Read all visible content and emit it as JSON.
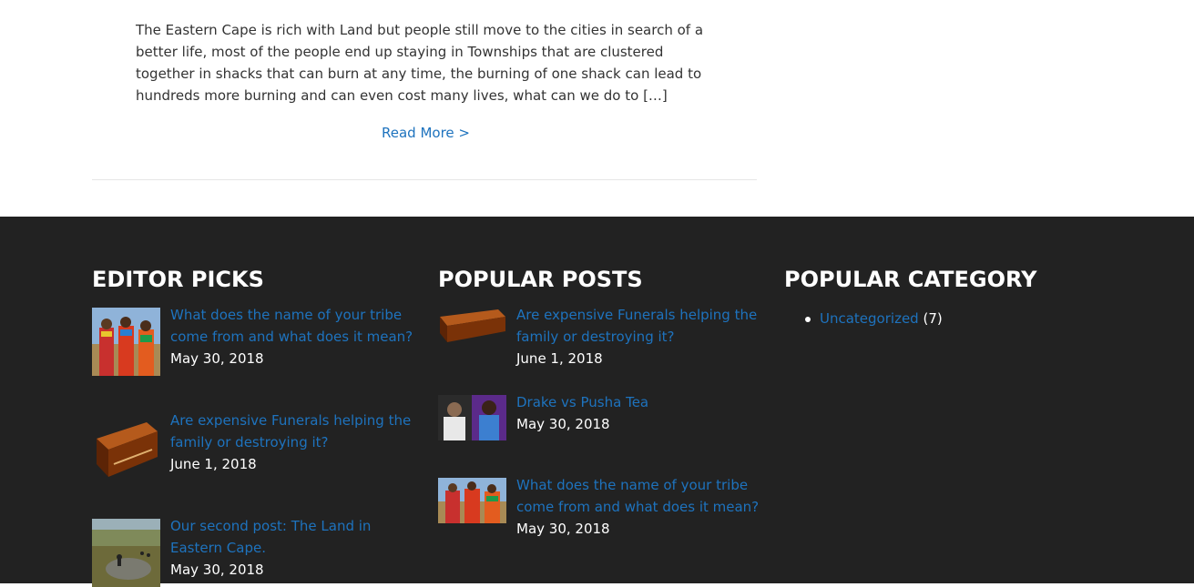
{
  "article": {
    "excerpt": "The Eastern Cape is rich with Land but people still move to the cities in search of a better life, most of the people end up staying in Townships that are clustered together in shacks that can burn at any time, the burning of one shack can lead to hundreds more burning and can even cost many lives, what can we do to […]",
    "read_more": "Read More >"
  },
  "footer": {
    "editor_picks": {
      "title": "EDITOR PICKS",
      "items": [
        {
          "title": "What does the name of your tribe come from and what does it mean?",
          "date": "May 30, 2018",
          "thumb": "tribe-photo"
        },
        {
          "title": "Are expensive Funerals helping the family or destroying it?",
          "date": "June 1, 2018",
          "thumb": "coffin-image"
        },
        {
          "title": "Our second post: The Land in Eastern Cape.",
          "date": "May 30, 2018",
          "thumb": "land-photo"
        }
      ]
    },
    "popular_posts": {
      "title": "POPULAR POSTS",
      "items": [
        {
          "title": "Are expensive Funerals helping the family or destroying it?",
          "date": "June 1, 2018",
          "thumb": "coffin-image"
        },
        {
          "title": "Drake vs Pusha Tea",
          "date": "May 30, 2018",
          "thumb": "drake-pusha-photo"
        },
        {
          "title": "What does the name of your tribe come from and what does it mean?",
          "date": "May 30, 2018",
          "thumb": "tribe-photo"
        }
      ]
    },
    "popular_category": {
      "title": "POPULAR CATEGORY",
      "items": [
        {
          "name": "Uncategorized",
          "count": "(7)"
        }
      ]
    }
  },
  "colors": {
    "link": "#1e73be",
    "footer_bg": "#222222",
    "text": "#333333"
  }
}
